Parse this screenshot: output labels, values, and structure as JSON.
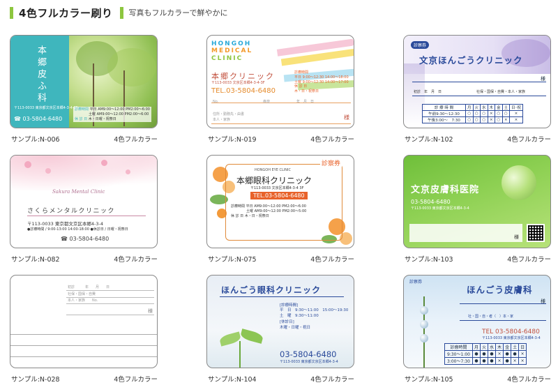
{
  "header": {
    "title": "4色フルカラー刷り",
    "subtitle": "写真もフルカラーで鮮やかに"
  },
  "samples": [
    {
      "caption": "サンプル:N-006",
      "type": "4色フルカラー",
      "name_vertical": "本郷皮ふ科",
      "address": "〒113-0033 東京都文京区本郷4-3-4-3F",
      "tel": "☎ 03-5804-6480",
      "hours_label": "診療時間",
      "hours": [
        "平日 AM9:00～12:00 PM2:00～6:00",
        "土曜 AM9:00～12:00 PM2:00～6:00"
      ],
      "closed_label": "休 診 日",
      "closed": "木・日曜・祝祭日"
    },
    {
      "caption": "サンプル:N-019",
      "type": "4色フルカラー",
      "en1": "HONGOH",
      "en2": "MEDICAL",
      "en3": "CLINIC",
      "name": "本郷クリニック",
      "address": "〒113-0033 文京区本郷4-3-4-3F",
      "tel": "TEL.03-5804-6480",
      "hours_label": "診療時間",
      "hours": [
        "平日 9:00～12:30 14:00～18:00",
        "土曜 9:00～12:30 14:00～17:00"
      ],
      "closed_label": "休 診 日",
      "closed": "木・日・祝祭日",
      "no_label": "No.",
      "ill_label": "疾症",
      "date": "年　月　日",
      "name_fields": "住所・勤務先・由書",
      "self": "本人・家族",
      "sama": "様"
    },
    {
      "caption": "サンプル:N-102",
      "type": "4色フルカラー",
      "badge": "診察券",
      "name": "文京ほんごうクリニック",
      "sama": "様",
      "first_visit": "初診　年　月　日",
      "insurance": "社保・国保・自費・本人・家族",
      "sched_head": [
        "診 療 時 間",
        "月",
        "火",
        "水",
        "木",
        "金",
        "土",
        "日･祝"
      ],
      "sched_rows": [
        [
          "午前9:30～12:30",
          "○",
          "○",
          "○",
          "×",
          "○",
          "○",
          "×"
        ],
        [
          "午後3:00～　7:30",
          "○",
          "○",
          "○",
          "×",
          "○",
          "×",
          "×"
        ]
      ]
    },
    {
      "caption": "サンプル:N-082",
      "type": "4色フルカラー",
      "en": "Sakura Mental Clinic",
      "name": "さくらメンタルクリニック",
      "address": "〒113-0033 東京都文京区本郷4-3-4",
      "hours": "●診療時間 / 9:00-13:00 14:00-18:00 ●休診日 / 日曜・祝祭日",
      "tel": "☎ 03-5804-6480"
    },
    {
      "caption": "サンプル:N-075",
      "type": "4色フルカラー",
      "badge": "診察券",
      "en": "HONGOH EYE CLINIC",
      "name": "本郷眼科クリニック",
      "address": "〒113-0033 文京区本郷4-3-4 3F",
      "tel": "TEL.03-5804-6480",
      "hours_label": "診療時間",
      "hours": [
        "平日 AM9:00～12:00 PM2:00～6:00",
        "土曜 AM9:00～12:00 PM2:00～5:00"
      ],
      "closed_label": "休 診 日",
      "closed": "木・日・祝祭日"
    },
    {
      "caption": "サンプル:N-103",
      "type": "4色フルカラー",
      "name": "文京皮膚科医院",
      "tel": "03-5804-6480",
      "address": "〒113-0033 東京都文京区本郷4-3-4",
      "sama": "様"
    },
    {
      "caption": "サンプル:N-028",
      "type": "4色フルカラー",
      "row1": "初診　　　年　　月　　日",
      "row2": "社保・国保・自費",
      "row3": "本人・家族　　No.",
      "sama": "様"
    },
    {
      "caption": "サンプル:N-104",
      "type": "4色フルカラー",
      "name": "ほんごう眼科クリニック",
      "hours_label": "[診療時間]",
      "hours": [
        "平　日　9:30～11:00　15:00～19:30",
        "土　曜　9:30～11:00"
      ],
      "closed_label": "[休診日]",
      "closed": "木曜・日曜・祝日",
      "tel": "03-5804-6480",
      "address": "〒113-0033 東京都文京区本郷4-3-4"
    },
    {
      "caption": "サンプル:N-105",
      "type": "4色フルカラー",
      "badge": "診察券",
      "name": "ほんごう皮膚科",
      "sama": "様",
      "insurance": "社・国・自・者（　）本・家",
      "tel": "TEL 03-5804-6480",
      "address": "〒113-0033 東京都文京区本郷4-3-4",
      "sched_head": [
        "診療時間",
        "月",
        "火",
        "水",
        "木",
        "金",
        "土",
        "日"
      ],
      "sched_rows": [
        [
          "9:30～1:00",
          "●",
          "●",
          "●",
          "×",
          "●",
          "●",
          "×"
        ],
        [
          "3:00～7:30",
          "●",
          "●",
          "●",
          "×",
          "●",
          "×",
          "×"
        ]
      ]
    }
  ]
}
